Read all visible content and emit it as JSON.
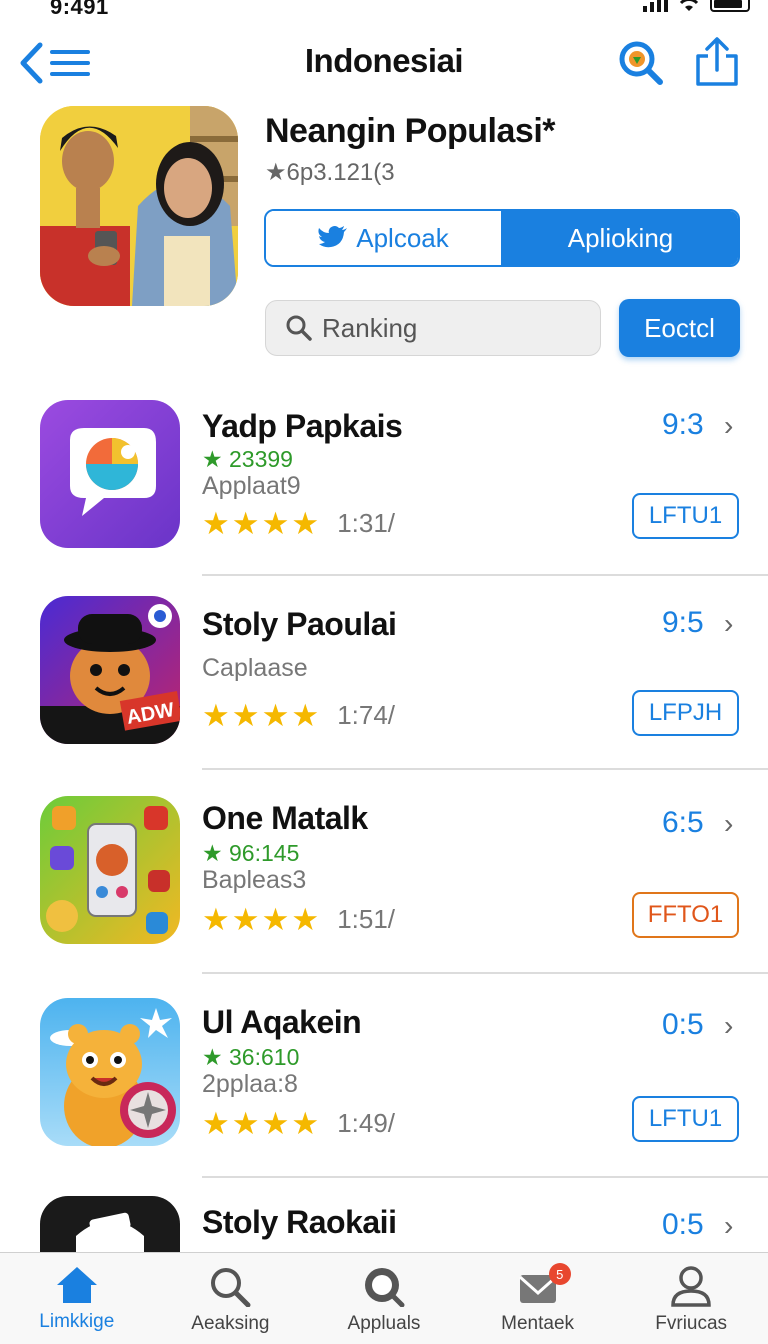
{
  "status": {
    "time": "9:491"
  },
  "nav": {
    "title": "Indonesiai"
  },
  "hero": {
    "title": "Neangin Populasi*",
    "rating": "★6p3.121(3",
    "segment_left": "Aplcoak",
    "segment_right": "Aplioking",
    "search_placeholder": "Ranking",
    "action_button": "Eoctcl"
  },
  "apps": [
    {
      "name": "Yadp Papkais",
      "count": "★ 23399",
      "subtitle": "Applaat9",
      "rating": "1:31/",
      "time": "9:3",
      "tag": "LFTU1"
    },
    {
      "name": "Stoly Paoulai",
      "count": "",
      "subtitle": "Caplaase",
      "rating": "1:74/",
      "time": "9:5",
      "tag": "LFPJH"
    },
    {
      "name": "One Matalk",
      "count": "★ 96:145",
      "subtitle": "Bapleas3",
      "rating": "1:51/",
      "time": "6:5",
      "tag": "FFTO1"
    },
    {
      "name": "Ul Aqakein",
      "count": "★ 36:610",
      "subtitle": "2pplaa:8",
      "rating": "1:49/",
      "time": "0:5",
      "tag": "LFTU1"
    },
    {
      "name": "Stoly Raokaii",
      "count": "",
      "subtitle": "",
      "rating": "",
      "time": "0:5",
      "tag": ""
    }
  ],
  "tabs": [
    {
      "label": "Limkkige",
      "icon": "home-icon"
    },
    {
      "label": "Aeaksing",
      "icon": "search-icon"
    },
    {
      "label": "Appluals",
      "icon": "apps-search-icon"
    },
    {
      "label": "Mentaek",
      "icon": "mail-icon",
      "badge": "5"
    },
    {
      "label": "Fvriucas",
      "icon": "person-icon"
    }
  ],
  "colors": {
    "accent": "#1a80e0",
    "star": "#f5b800",
    "count": "#2e9a2a",
    "tag_orange": "#e0561a"
  }
}
